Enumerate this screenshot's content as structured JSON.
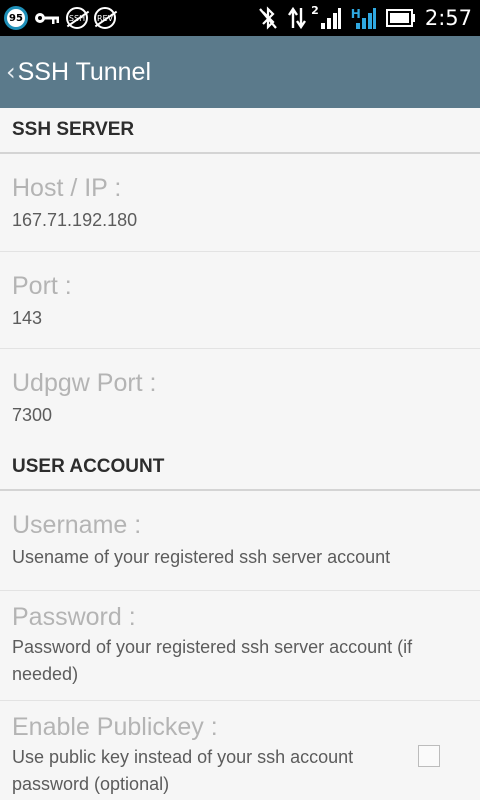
{
  "status_bar": {
    "battery_level_badge": "95",
    "ssh_badge": "SSH",
    "rev_badge": "REV",
    "data_indicator": "2",
    "network_type": "H",
    "time": "2:57",
    "icons": [
      "vpn-key-icon",
      "ssh-icon",
      "rev-icon",
      "bluetooth-off-icon",
      "data-transfer-icon",
      "signal-icon",
      "signal-h-icon",
      "battery-icon"
    ]
  },
  "action_bar": {
    "back_glyph": "‹",
    "title": "SSH Tunnel"
  },
  "sections": [
    {
      "header": "SSH SERVER",
      "items": [
        {
          "title": "Host / IP :",
          "summary": "167.71.192.180"
        },
        {
          "title": "Port :",
          "summary": "143"
        },
        {
          "title": "Udpgw Port :",
          "summary": "7300"
        }
      ]
    },
    {
      "header": "USER ACCOUNT",
      "items": [
        {
          "title": "Username :",
          "summary": "Usename of your registered ssh server account"
        },
        {
          "title": "Password :",
          "summary": "Password of your registered ssh server account (if needed)"
        },
        {
          "title": "Enable Publickey :",
          "summary": "Use public key instead of your ssh account password (optional)",
          "checked": false
        }
      ]
    }
  ],
  "colors": {
    "action_bar": "#5b7a8b",
    "status_bar": "#000000",
    "background": "#f6f6f6",
    "pref_title": "#b4b4b4",
    "pref_summary": "#5c5c5c",
    "signal_accent": "#2fa8e0"
  }
}
